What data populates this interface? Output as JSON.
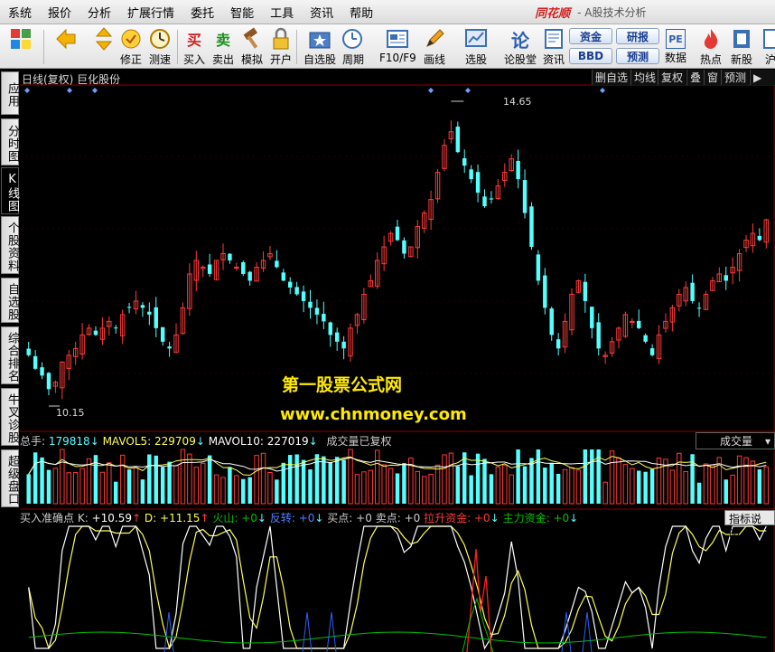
{
  "menu": {
    "items": [
      "系统",
      "报价",
      "分析",
      "扩展行情",
      "委托",
      "智能",
      "工具",
      "资讯",
      "帮助"
    ],
    "brand": "同花顺",
    "brand_sub": "- A股技术分析"
  },
  "toolbar": {
    "buttons": [
      {
        "label": "",
        "icon": "multiwindow-icon"
      },
      {
        "label": "",
        "icon": "back-arrow-icon"
      },
      {
        "label": "",
        "icon": "up-down-arrows-icon"
      },
      {
        "label": "修正",
        "icon": "modify-icon"
      },
      {
        "label": "测速",
        "icon": "speed-test-icon"
      },
      {
        "label": "买入",
        "icon": "buy-icon",
        "glyph": "买"
      },
      {
        "label": "卖出",
        "icon": "sell-icon",
        "glyph": "卖"
      },
      {
        "label": "模拟",
        "icon": "hammer-icon"
      },
      {
        "label": "开户",
        "icon": "lock-icon"
      },
      {
        "label": "自选股",
        "icon": "star-folder-icon"
      },
      {
        "label": "周期",
        "icon": "clock-icon"
      },
      {
        "label": "F10/F9",
        "icon": "f10-icon"
      },
      {
        "label": "画线",
        "icon": "pencil-icon"
      },
      {
        "label": "选股",
        "icon": "stock-pick-icon"
      },
      {
        "label": "论股堂",
        "icon": "forum-icon",
        "glyph": "论"
      },
      {
        "label": "资讯",
        "icon": "news-icon"
      },
      {
        "label": "数据",
        "icon": "pe-data-icon",
        "glyph": "PE"
      },
      {
        "label": "热点",
        "icon": "hot-icon"
      },
      {
        "label": "新股",
        "icon": "new-stock-icon"
      },
      {
        "label": "沪",
        "icon": "sh-icon"
      }
    ],
    "pills": [
      "资金",
      "研报",
      "BBD",
      "预测"
    ]
  },
  "sidetabs": [
    {
      "label": "应用",
      "active": false
    },
    {
      "label": "分时图",
      "active": false
    },
    {
      "label": "K线图",
      "active": true
    },
    {
      "label": "个股资料",
      "active": false
    },
    {
      "label": "自选股",
      "active": false
    },
    {
      "label": "综合排名",
      "active": false
    },
    {
      "label": "牛叉诊股",
      "active": false
    },
    {
      "label": "超级盘口",
      "active": false
    }
  ],
  "chart_header": {
    "title": "日线(复权)  巨化股份",
    "right_buttons": [
      "删自选",
      "均线",
      "复权",
      "叠",
      "窗",
      "预测"
    ]
  },
  "price_labels": {
    "high": "14.65",
    "low": "10.15"
  },
  "watermark": {
    "line1": "第一股票公式网",
    "line2": "www.chnmoney.com"
  },
  "volume_legend": {
    "total_label": "总手:",
    "total_value": "179818",
    "mavol5_label": "MAVOL5:",
    "mavol5_value": "229709",
    "mavol10_label": "MAVOL10:",
    "mavol10_value": "227019",
    "note": "成交量已复权",
    "selector": "成交量"
  },
  "indicator_legend": {
    "name": "买入准确点",
    "k_label": "K:",
    "k_value": "+10.59",
    "d_label": "D:",
    "d_value": "+11.15",
    "huoshan_label": "火山:",
    "huoshan_value": "+0",
    "fanzhuan_label": "反转:",
    "fanzhuan_value": "+0",
    "maidian_label": "买点:",
    "maidian_value": "+0",
    "maidian2_label": "卖点:",
    "maidian2_value": "+0",
    "lasheng_label": "拉升资金:",
    "lasheng_value": "+0",
    "zhuli_label": "主力资金:",
    "zhuli_value": "+0",
    "help_button": "指标说明"
  },
  "colors": {
    "up": "#ff3a3a",
    "down": "#54ffff",
    "axis": "#8b0000",
    "k_line": "#ffffff",
    "d_line": "#ffff55",
    "green_line": "#00c000",
    "red_line": "#ff2020",
    "blue_line": "#3060ff"
  },
  "chart_data": {
    "type": "candlestick",
    "title": "日线(复权)  巨化股份",
    "price_high": 14.65,
    "price_low": 10.15,
    "closes": [
      10.9,
      10.7,
      10.6,
      10.4,
      10.5,
      10.8,
      10.9,
      11.0,
      11.2,
      11.3,
      11.2,
      11.3,
      11.4,
      11.3,
      11.5,
      11.6,
      11.7,
      11.6,
      11.5,
      11.3,
      11.1,
      11.0,
      11.2,
      11.6,
      12.1,
      12.3,
      12.2,
      12.1,
      12.3,
      12.4,
      12.3,
      12.2,
      12.1,
      12.0,
      12.2,
      12.3,
      12.4,
      12.2,
      12.0,
      11.9,
      11.8,
      11.7,
      11.6,
      11.5,
      11.4,
      11.2,
      11.1,
      11.0,
      11.3,
      11.5,
      11.8,
      12.0,
      12.3,
      12.5,
      12.7,
      12.6,
      12.4,
      12.5,
      12.8,
      13.0,
      13.2,
      13.6,
      14.0,
      14.2,
      13.9,
      13.7,
      13.5,
      13.3,
      13.1,
      13.2,
      13.4,
      13.6,
      13.8,
      13.5,
      13.0,
      12.5,
      12.0,
      11.6,
      11.2,
      11.0,
      11.4,
      11.8,
      12.0,
      11.7,
      11.3,
      11.0,
      10.9,
      11.1,
      11.3,
      11.5,
      11.4,
      11.3,
      11.1,
      10.9,
      11.2,
      11.4,
      11.6,
      11.8,
      11.9,
      11.7,
      11.6,
      11.8,
      12.0,
      12.1,
      12.0,
      12.2,
      12.4,
      12.6,
      12.7,
      12.6,
      12.9
    ]
  }
}
